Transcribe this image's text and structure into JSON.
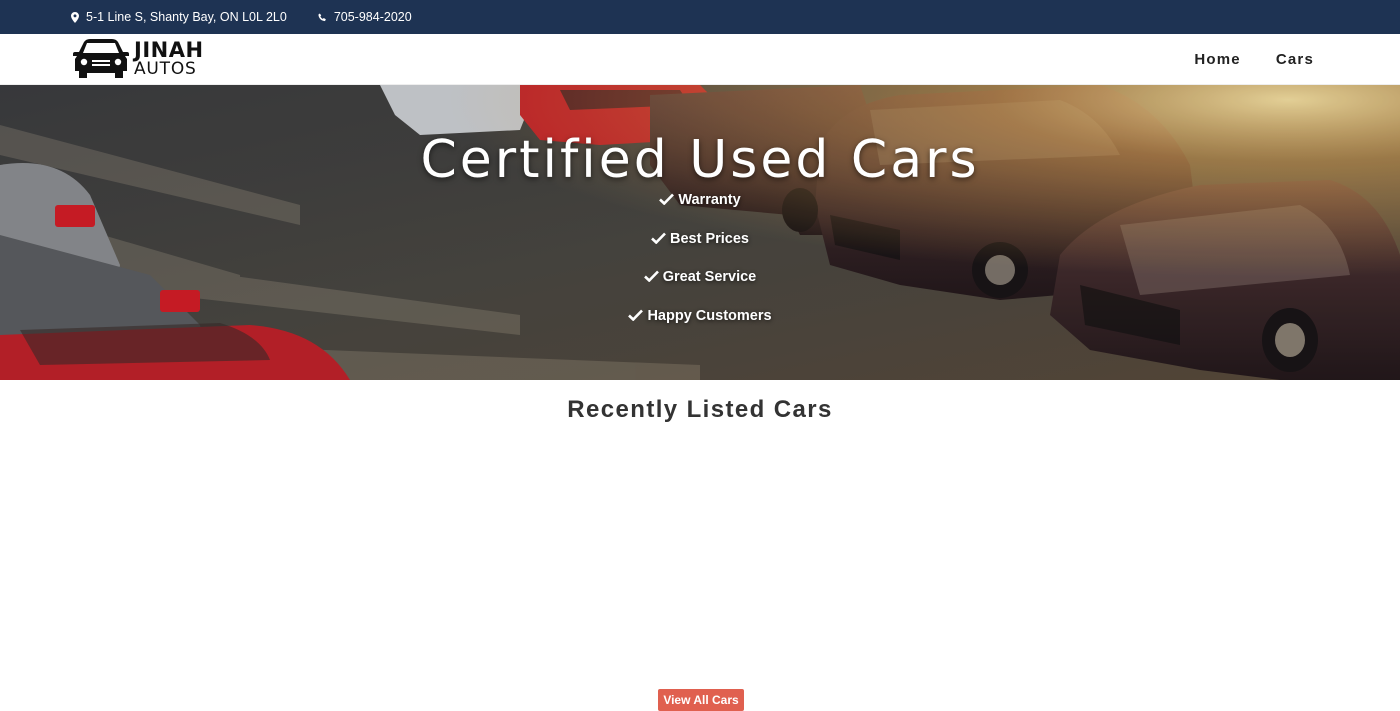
{
  "topbar": {
    "address": "5-1 Line S, Shanty Bay, ON L0L 2L0",
    "phone": "705-984-2020",
    "address_icon": "map-marker-icon",
    "phone_icon": "phone-icon"
  },
  "brand": {
    "line1": "JINAH",
    "line2": "AUTOS",
    "icon": "car-front-icon"
  },
  "nav": {
    "items": [
      {
        "label": "Home"
      },
      {
        "label": "Cars"
      }
    ]
  },
  "hero": {
    "title": "Certified Used Cars",
    "features": [
      {
        "label": "Warranty"
      },
      {
        "label": "Best Prices"
      },
      {
        "label": "Great Service"
      },
      {
        "label": "Happy Customers"
      }
    ],
    "feature_icon": "check-icon"
  },
  "recent": {
    "title": "Recently Listed Cars",
    "view_all_label": "View All Cars"
  },
  "colors": {
    "topbar_bg": "#1e3353",
    "accent": "#e0604f"
  }
}
